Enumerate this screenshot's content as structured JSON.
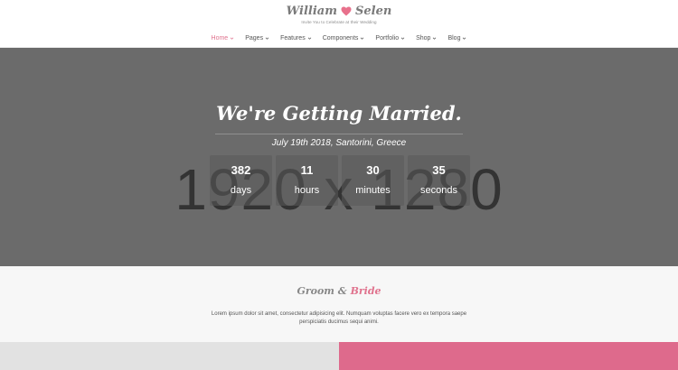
{
  "header": {
    "name_left": "William",
    "name_right": "Selen",
    "tagline": "Invite You to Celebrate at their Wedding",
    "heart_color": "#e8718c"
  },
  "nav": {
    "items": [
      {
        "label": "Home",
        "active": true
      },
      {
        "label": "Pages"
      },
      {
        "label": "Features"
      },
      {
        "label": "Components"
      },
      {
        "label": "Portfolio"
      },
      {
        "label": "Shop"
      },
      {
        "label": "Blog"
      }
    ]
  },
  "hero": {
    "placeholder": "1920 x 1280",
    "title": "We're Getting Married.",
    "date": "July 19th 2018, Santorini, Greece",
    "countdown": [
      {
        "value": "382",
        "label": "days"
      },
      {
        "value": "11",
        "label": "hours"
      },
      {
        "value": "30",
        "label": "minutes"
      },
      {
        "value": "35",
        "label": "seconds"
      }
    ]
  },
  "section": {
    "title_groom": "Groom",
    "title_amp": "&",
    "title_bride": "Bride",
    "text_line1": "Lorem ipsum dolor sit amet, consectetur adipisicing elit. Numquam voluptas facere vero ex tempora saepe",
    "text_line2": "perspiciatis ducimus sequi animi."
  },
  "colors": {
    "accent": "#e0738e",
    "hero_bg": "#6b6b6b",
    "panel_left": "#e2e2e2",
    "panel_right": "#de6a8c"
  }
}
